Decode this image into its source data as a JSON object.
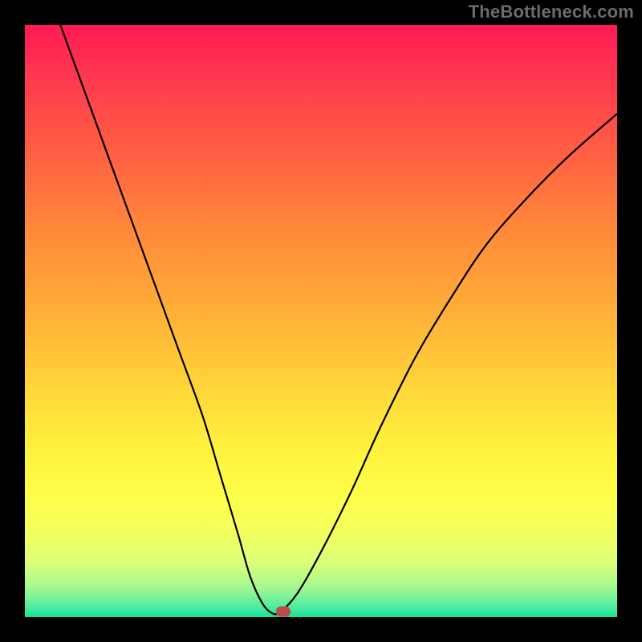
{
  "watermark": "TheBottleneck.com",
  "chart_data": {
    "type": "line",
    "title": "",
    "xlabel": "",
    "ylabel": "",
    "xlim": [
      0,
      100
    ],
    "ylim": [
      0,
      100
    ],
    "series": [
      {
        "name": "curve",
        "x": [
          6,
          10,
          14,
          18,
          22,
          26,
          30,
          33,
          36,
          38,
          40,
          41.5,
          43,
          46,
          50,
          55,
          60,
          66,
          72,
          78,
          85,
          92,
          100
        ],
        "values": [
          100,
          89,
          78,
          67,
          56,
          45,
          34,
          24,
          14,
          7,
          2.5,
          0.8,
          0.8,
          4,
          11,
          21,
          32,
          44,
          54,
          63,
          71,
          78,
          85
        ]
      }
    ],
    "marker": {
      "x": 43.6,
      "y": 0.9
    },
    "gradient_stops": [
      {
        "pos": 0.0,
        "color": "#ff1a54"
      },
      {
        "pos": 0.2,
        "color": "#ff5a44"
      },
      {
        "pos": 0.5,
        "color": "#ffb338"
      },
      {
        "pos": 0.72,
        "color": "#fff23d"
      },
      {
        "pos": 0.91,
        "color": "#d9ff7a"
      },
      {
        "pos": 1.0,
        "color": "#14e29a"
      }
    ]
  }
}
